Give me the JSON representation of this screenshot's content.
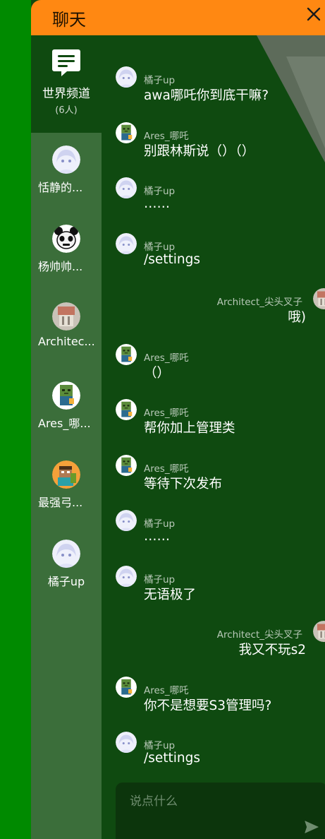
{
  "header": {
    "title": "聊天"
  },
  "world_channel": {
    "label": "世界频道",
    "count": "(6人)"
  },
  "members": [
    {
      "name": "恬静的...",
      "avatar": "anime-girl-avatar"
    },
    {
      "name": "杨帅帅...",
      "avatar": "panda-meme-avatar"
    },
    {
      "name": "Architec...",
      "avatar": "blurry-photo-avatar"
    },
    {
      "name": "Ares_哪...",
      "avatar": "minecraft-zombie-avatar"
    },
    {
      "name": "最强弓...",
      "avatar": "minecraft-steve-avatar"
    },
    {
      "name": "橘子up",
      "avatar": "anime-girl-avatar"
    }
  ],
  "messages": [
    {
      "sender": "橘子up",
      "text": "awa哪吒你到底干嘛?",
      "side": "left",
      "avatar": "anime-girl-avatar"
    },
    {
      "sender": "Ares_哪吒",
      "text": "别跟林斯说（）（）",
      "side": "left",
      "avatar": "minecraft-zombie-avatar"
    },
    {
      "sender": "橘子up",
      "text": "……",
      "side": "left",
      "avatar": "anime-girl-avatar"
    },
    {
      "sender": "橘子up",
      "text": "/settings",
      "side": "left",
      "avatar": "anime-girl-avatar"
    },
    {
      "sender": "Architect_尖头叉子",
      "text": "哦)",
      "side": "right",
      "avatar": "blurry-photo-avatar"
    },
    {
      "sender": "Ares_哪吒",
      "text": "（）",
      "side": "left",
      "avatar": "minecraft-zombie-avatar"
    },
    {
      "sender": "Ares_哪吒",
      "text": "帮你加上管理类",
      "side": "left",
      "avatar": "minecraft-zombie-avatar"
    },
    {
      "sender": "Ares_哪吒",
      "text": "等待下次发布",
      "side": "left",
      "avatar": "minecraft-zombie-avatar"
    },
    {
      "sender": "橘子up",
      "text": "……",
      "side": "left",
      "avatar": "anime-girl-avatar"
    },
    {
      "sender": "橘子up",
      "text": "无语极了",
      "side": "left",
      "avatar": "anime-girl-avatar"
    },
    {
      "sender": "Architect_尖头叉子",
      "text": "我又不玩s2",
      "side": "right",
      "avatar": "blurry-photo-avatar"
    },
    {
      "sender": "Ares_哪吒",
      "text": "你不是想要S3管理吗?",
      "side": "left",
      "avatar": "minecraft-zombie-avatar"
    },
    {
      "sender": "橘子up",
      "text": "/settings",
      "side": "left",
      "avatar": "anime-girl-avatar"
    }
  ],
  "input": {
    "placeholder": "说点什么",
    "value": ""
  },
  "colors": {
    "header": "#ff8812",
    "panel": "#0f4a10",
    "sidebar_list": "#3b6e3a",
    "page_bg": "#008a00",
    "input_bg": "#0c350c"
  }
}
